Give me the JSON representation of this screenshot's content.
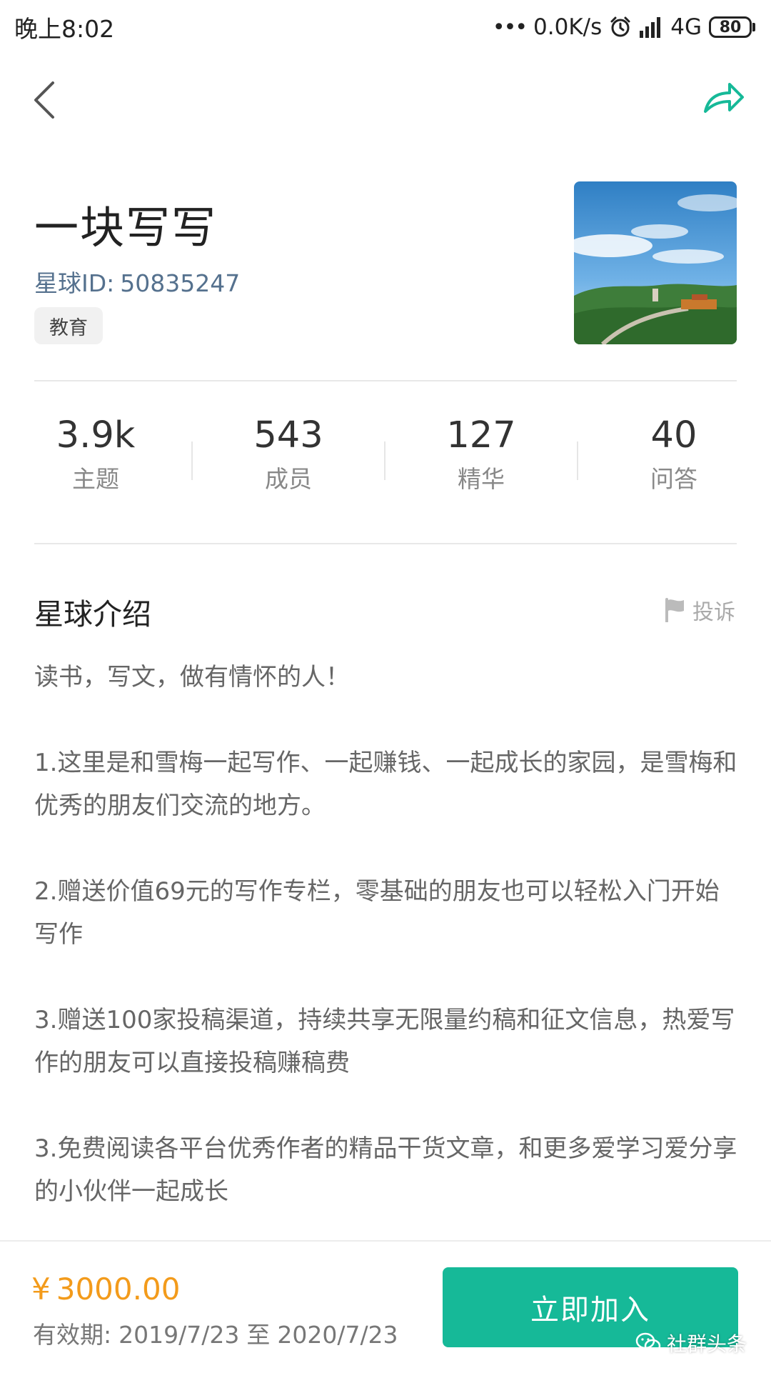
{
  "status_bar": {
    "time": "晚上8:02",
    "network_speed": "0.0K/s",
    "network_type": "4G",
    "battery": "80"
  },
  "nav": {
    "back_icon": "chevron-left-icon",
    "share_icon": "share-arrow-icon",
    "share_color": "#16b998"
  },
  "group": {
    "title": "一块写写",
    "id_label": "星球ID:",
    "id_value": "50835247",
    "category": "教育"
  },
  "stats": [
    {
      "value": "3.9k",
      "label": "主题"
    },
    {
      "value": "543",
      "label": "成员"
    },
    {
      "value": "127",
      "label": "精华"
    },
    {
      "value": "40",
      "label": "问答"
    }
  ],
  "intro": {
    "heading": "星球介绍",
    "report_label": "投诉",
    "paragraphs": [
      "读书，写文，做有情怀的人！",
      "1.这里是和雪梅一起写作、一起赚钱、一起成长的家园，是雪梅和优秀的朋友们交流的地方。",
      "2.赠送价值69元的写作专栏，零基础的朋友也可以轻松入门开始写作",
      "3.赠送100家投稿渠道，持续共享无限量约稿和征文信息，热爱写作的朋友可以直接投稿赚稿费",
      "3.免费阅读各平台优秀作者的精品干货文章，和更多爱学习爱分享的小伙伴一起成长"
    ]
  },
  "footer": {
    "price_symbol": "¥",
    "price": "3000.00",
    "price_color": "#f39b1b",
    "validity_label": "有效期:",
    "validity_start": "2019/7/23",
    "validity_sep": "至",
    "validity_end": "2020/7/23",
    "join_label": "立即加入",
    "join_color": "#16b998",
    "watermark": "社群头条"
  }
}
